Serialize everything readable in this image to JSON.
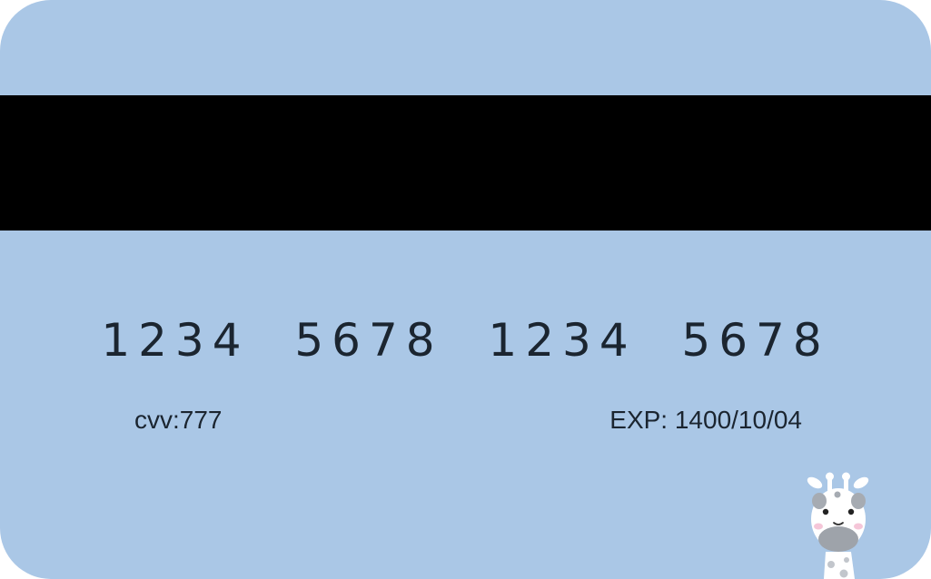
{
  "card": {
    "number": "1234  5678  1234  5678",
    "cvv_text": "cvv:777",
    "exp_text": "EXP: 1400/10/04"
  },
  "colors": {
    "card_background": "#aac7e6",
    "magnetic_stripe": "#000000",
    "text": "#1b2530"
  },
  "icons": {
    "mascot": "giraffe-icon"
  }
}
